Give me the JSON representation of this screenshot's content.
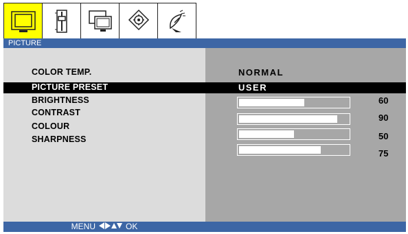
{
  "tabs": [
    {
      "icon": "tv-screen-icon",
      "active": true
    },
    {
      "icon": "audio-fader-icon",
      "active": false
    },
    {
      "icon": "dual-monitor-icon",
      "active": false
    },
    {
      "icon": "settings-gear-icon",
      "active": false
    },
    {
      "icon": "satellite-dish-icon",
      "active": false
    }
  ],
  "header": {
    "title": "PICTURE"
  },
  "menu": {
    "color_temp": {
      "label": "COLOR TEMP.",
      "value": "NORMAL"
    },
    "picture_preset": {
      "label": "PICTURE PRESET",
      "value": "USER"
    },
    "brightness": {
      "label": "BRIGHTNESS",
      "value": "60",
      "level": 0.6
    },
    "contrast": {
      "label": "CONTRAST",
      "value": "90",
      "level": 0.9
    },
    "colour": {
      "label": "COLOUR",
      "value": "50",
      "level": 0.5
    },
    "sharpness": {
      "label": "SHARPNESS",
      "value": "75",
      "level": 0.75
    }
  },
  "footer": {
    "menu_label": "MENU",
    "ok_label": "OK"
  },
  "colors": {
    "accent": "#3d66a5",
    "active_tab": "#ffff00",
    "left_panel": "#dcdcdc",
    "right_panel": "#a7a7a7"
  }
}
